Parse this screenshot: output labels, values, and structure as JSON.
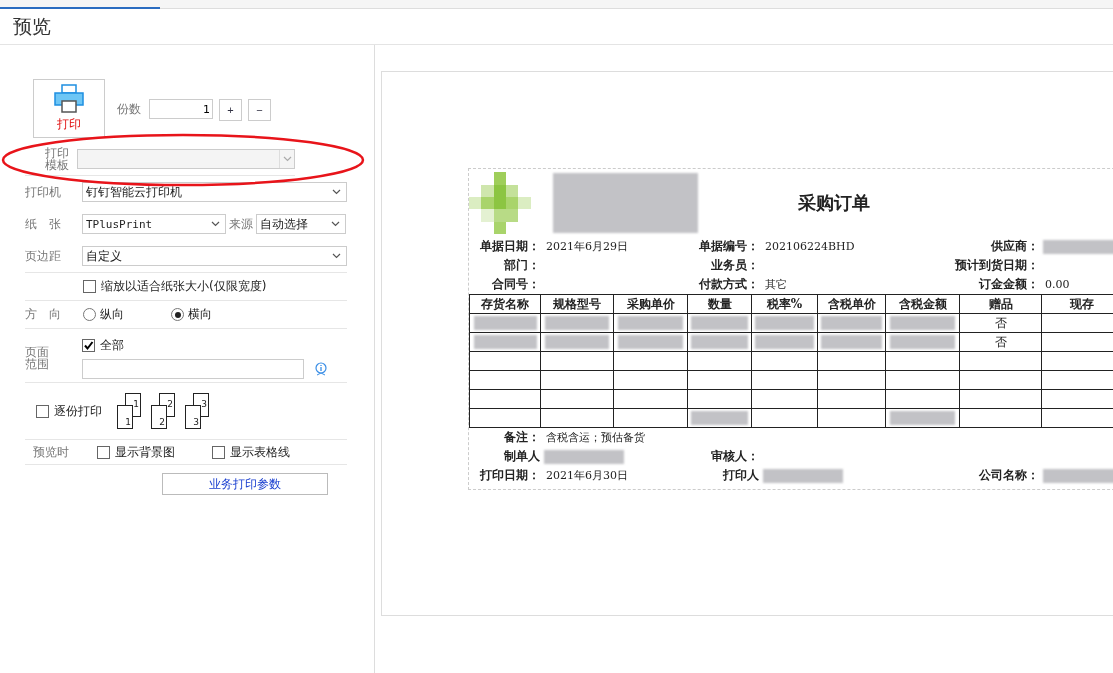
{
  "window": {
    "title": "预览"
  },
  "print_button": {
    "label": "打印"
  },
  "copies": {
    "label": "份数",
    "value": "1",
    "plus": "+",
    "minus": "−"
  },
  "template": {
    "label": "打印模板"
  },
  "printer": {
    "label": "打印机",
    "value": "钉钉智能云打印机"
  },
  "paper": {
    "label": "纸　张",
    "value": "TPlusPrint",
    "source_label": "来源",
    "source_value": "自动选择"
  },
  "margin": {
    "label": "页边距",
    "value": "自定义"
  },
  "fit": {
    "label": "缩放以适合纸张大小(仅限宽度)",
    "checked": false
  },
  "orientation": {
    "label": "方　向",
    "options": [
      {
        "label": "纵向",
        "selected": false
      },
      {
        "label": "横向",
        "selected": true
      }
    ]
  },
  "page_range": {
    "label": "页面范围",
    "all_label": "全部",
    "all_checked": true
  },
  "collate": {
    "label": "逐份打印",
    "checked": false,
    "sets": [
      {
        "back": "1",
        "front": "1"
      },
      {
        "back": "2",
        "front": "2"
      },
      {
        "back": "3",
        "front": "3"
      }
    ]
  },
  "preview_options": {
    "label": "预览时",
    "items": [
      {
        "label": "显示背景图",
        "checked": false
      },
      {
        "label": "显示表格线",
        "checked": false
      }
    ]
  },
  "params_button": {
    "label": "业务打印参数"
  },
  "document": {
    "title": "采购订单",
    "header_rows": [
      [
        {
          "label": "单据日期：",
          "value": "2021年6月29日"
        },
        {
          "label": "单据编号：",
          "value": "202106224BHD"
        },
        {
          "label": "供应商：",
          "redacted": true
        }
      ],
      [
        {
          "label": "部门："
        },
        {
          "label": "业务员："
        },
        {
          "label": "预计到货日期："
        }
      ],
      [
        {
          "label": "合同号："
        },
        {
          "label": "付款方式：",
          "value": "其它"
        },
        {
          "label": "订金金额：",
          "value": "0.00"
        }
      ]
    ],
    "columns": [
      "存货名称",
      "规格型号",
      "采购单价",
      "数量",
      "税率%",
      "含税单价",
      "含税金额",
      "赠品",
      "现存"
    ],
    "rows": [
      {
        "kind": "item",
        "gift": "否"
      },
      {
        "kind": "item",
        "gift": "否"
      },
      {
        "kind": "blank"
      },
      {
        "kind": "blank"
      },
      {
        "kind": "blank"
      },
      {
        "kind": "total"
      }
    ],
    "note": {
      "label": "备注：",
      "value": "含税含运；预估备货"
    },
    "footer_rows": [
      [
        {
          "label": "制单人",
          "redacted": true
        },
        {
          "label": "审核人："
        }
      ],
      [
        {
          "label": "打印日期：",
          "value": "2021年6月30日"
        },
        {
          "label": "打印人",
          "redacted": true
        },
        {
          "label": "公司名称：",
          "redacted": true
        }
      ]
    ]
  }
}
